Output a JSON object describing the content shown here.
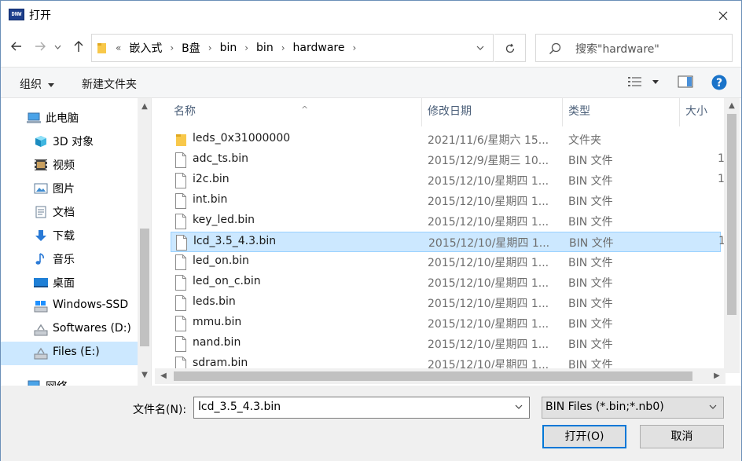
{
  "title": "打开",
  "title_icon_text": "DNW",
  "address": {
    "prefix": "«",
    "crumbs": [
      "嵌入式",
      "B盘",
      "bin",
      "bin",
      "hardware"
    ]
  },
  "search": {
    "placeholder": "搜索\"hardware\""
  },
  "toolbar": {
    "organize": "组织",
    "new_folder": "新建文件夹"
  },
  "sidebar": {
    "items": [
      {
        "label": "此电脑",
        "icon": "computer-icon"
      },
      {
        "label": "3D 对象",
        "icon": "3d-objects-icon"
      },
      {
        "label": "视频",
        "icon": "video-icon"
      },
      {
        "label": "图片",
        "icon": "pictures-icon"
      },
      {
        "label": "文档",
        "icon": "documents-icon"
      },
      {
        "label": "下载",
        "icon": "download-icon"
      },
      {
        "label": "音乐",
        "icon": "music-icon"
      },
      {
        "label": "桌面",
        "icon": "desktop-icon"
      },
      {
        "label": "Windows-SSD",
        "icon": "drive-icon"
      },
      {
        "label": "Softwares (D:)",
        "icon": "drive-icon"
      },
      {
        "label": "Files (E:)",
        "icon": "drive-icon",
        "selected": true
      },
      {
        "label": "网络",
        "icon": "network-icon"
      }
    ]
  },
  "columns": {
    "name": "名称",
    "date": "修改日期",
    "type": "类型",
    "size": "大小"
  },
  "files": [
    {
      "name": "leds_0x31000000",
      "date": "2021/11/6/星期六 15...",
      "type": "文件夹",
      "size": "",
      "kind": "folder"
    },
    {
      "name": "adc_ts.bin",
      "date": "2015/12/9/星期三 10...",
      "type": "BIN 文件",
      "size": "1",
      "kind": "file"
    },
    {
      "name": "i2c.bin",
      "date": "2015/12/10/星期四 1...",
      "type": "BIN 文件",
      "size": "1",
      "kind": "file"
    },
    {
      "name": "int.bin",
      "date": "2015/12/10/星期四 1...",
      "type": "BIN 文件",
      "size": "",
      "kind": "file"
    },
    {
      "name": "key_led.bin",
      "date": "2015/12/10/星期四 1...",
      "type": "BIN 文件",
      "size": "",
      "kind": "file"
    },
    {
      "name": "lcd_3.5_4.3.bin",
      "date": "2015/12/10/星期四 1...",
      "type": "BIN 文件",
      "size": "1",
      "kind": "file",
      "selected": true
    },
    {
      "name": "led_on.bin",
      "date": "2015/12/10/星期四 1...",
      "type": "BIN 文件",
      "size": "",
      "kind": "file"
    },
    {
      "name": "led_on_c.bin",
      "date": "2015/12/10/星期四 1...",
      "type": "BIN 文件",
      "size": "",
      "kind": "file"
    },
    {
      "name": "leds.bin",
      "date": "2015/12/10/星期四 1...",
      "type": "BIN 文件",
      "size": "",
      "kind": "file"
    },
    {
      "name": "mmu.bin",
      "date": "2015/12/10/星期四 1...",
      "type": "BIN 文件",
      "size": "",
      "kind": "file"
    },
    {
      "name": "nand.bin",
      "date": "2015/12/10/星期四 1...",
      "type": "BIN 文件",
      "size": "",
      "kind": "file"
    },
    {
      "name": "sdram.bin",
      "date": "2015/12/10/星期四 1...",
      "type": "BIN 文件",
      "size": "",
      "kind": "file"
    }
  ],
  "bottom": {
    "filename_label": "文件名(N):",
    "filename_value": "lcd_3.5_4.3.bin",
    "filter_value": "BIN Files (*.bin;*.nb0)",
    "open_label": "打开(O)",
    "cancel_label": "取消"
  },
  "colors": {
    "accent": "#0078d7",
    "selection": "#cce8ff",
    "folder": "#f8c84a",
    "help": "#1a73c9"
  }
}
